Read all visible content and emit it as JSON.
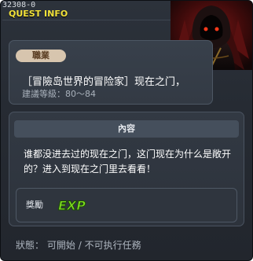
{
  "header": {
    "quest_id": "32308-0",
    "section_title": "QUEST INFO"
  },
  "portrait": {
    "icon": "hooded-dark-figure-portrait"
  },
  "job": {
    "label": "職業",
    "quest_title": "［冒險岛世界的冒险家］现在之门，",
    "recommend_level": "建議等級：80～84"
  },
  "content": {
    "header": "內容",
    "description": "谁都没进去过的现在之门，这门现在为什么是敞开的？进入到现在之门里去看看！"
  },
  "reward": {
    "label": "獎勵",
    "exp_text": "EXP",
    "exp_icon": "exp-icon"
  },
  "status": {
    "label": "狀態：",
    "startable": "可開始",
    "separator": "/",
    "not_executable": "不可执行任務"
  },
  "colors": {
    "background": "#262b33",
    "accent_yellow": "#f2e23a",
    "pill": "#d7c5ae",
    "exp_green": "#7ddc1f"
  }
}
